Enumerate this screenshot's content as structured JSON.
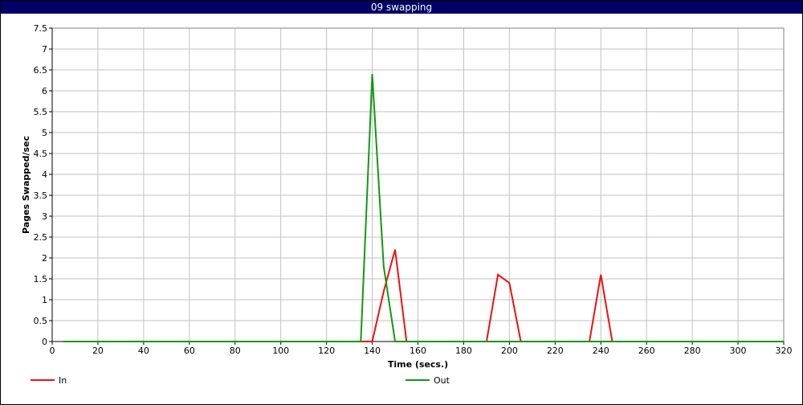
{
  "window": {
    "title": "09 swapping"
  },
  "chart_data": {
    "type": "line",
    "title": "09 swapping",
    "xlabel": "Time (secs.)",
    "ylabel": "Pages Swapped/sec",
    "xlim": [
      0,
      320
    ],
    "ylim": [
      0,
      7.5
    ],
    "xticks": [
      0,
      20,
      40,
      60,
      80,
      100,
      120,
      140,
      160,
      180,
      200,
      220,
      240,
      260,
      280,
      300,
      320
    ],
    "yticks": [
      0,
      0.5,
      1,
      1.5,
      2,
      2.5,
      3,
      3.5,
      4,
      4.5,
      5,
      5.5,
      6,
      6.5,
      7,
      7.5
    ],
    "grid": true,
    "legend_position": "bottom",
    "series": [
      {
        "name": "In",
        "color": "#ee1111",
        "x": [
          5,
          140,
          145,
          150,
          155,
          190,
          195,
          200,
          205,
          235,
          240,
          245,
          320
        ],
        "y": [
          0,
          0,
          1.2,
          2.2,
          0,
          0,
          1.6,
          1.4,
          0,
          0,
          1.6,
          0,
          0
        ]
      },
      {
        "name": "Out",
        "color": "#119911",
        "x": [
          5,
          135,
          140,
          145,
          150,
          320
        ],
        "y": [
          0,
          0,
          6.4,
          1.8,
          0,
          0
        ]
      }
    ]
  }
}
